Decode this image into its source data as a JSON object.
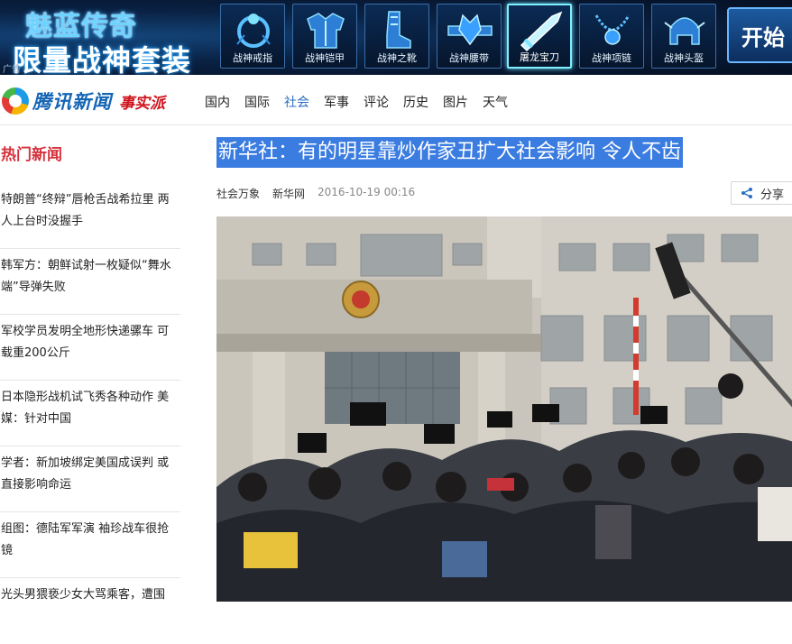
{
  "banner": {
    "headline1": "魅蓝传奇",
    "headline2": "限量战神套装",
    "ad_tag": "广告",
    "items": [
      {
        "label": "战神戒指",
        "icon": "ring-icon",
        "selected": false
      },
      {
        "label": "战神铠甲",
        "icon": "armor-icon",
        "selected": false
      },
      {
        "label": "战神之靴",
        "icon": "boots-icon",
        "selected": false
      },
      {
        "label": "战神腰带",
        "icon": "belt-icon",
        "selected": false
      },
      {
        "label": "屠龙宝刀",
        "icon": "sword-icon",
        "selected": true
      },
      {
        "label": "战神项链",
        "icon": "necklace-icon",
        "selected": false
      },
      {
        "label": "战神头盔",
        "icon": "helmet-icon",
        "selected": false
      }
    ],
    "start_label": "开始"
  },
  "logo": {
    "brand": "腾讯新闻",
    "sub_brand": "事实派"
  },
  "nav": {
    "items": [
      "国内",
      "国际",
      "社会",
      "军事",
      "评论",
      "历史",
      "图片",
      "天气"
    ],
    "active": "社会"
  },
  "sidebar": {
    "title": "热门新闻",
    "news": [
      "特朗普“终辩”唇枪舌战希拉里 两人上台时没握手",
      "韩军方：朝鲜试射一枚疑似“舞水端”导弹失败",
      "军校学员发明全地形快递骡车 可载重200公斤",
      "日本隐形战机试飞秀各种动作 美媒：针对中国",
      "学者：新加坡绑定美国成误判 或直接影响命运",
      "组图：德陆军军演 袖珍战车很抢镜",
      "光头男猥亵少女大骂乘客，遭围"
    ]
  },
  "article": {
    "headline": "新华社：有的明星靠炒作家丑扩大社会影响 令人不齿",
    "channel": "社会万象",
    "source": "新华网",
    "time": "2016-10-19 00:16",
    "share_label": "分享"
  },
  "colors": {
    "accent_red": "#d6313c",
    "nav_active": "#2b6fc4",
    "headline_highlight": "#3b7ce0"
  }
}
